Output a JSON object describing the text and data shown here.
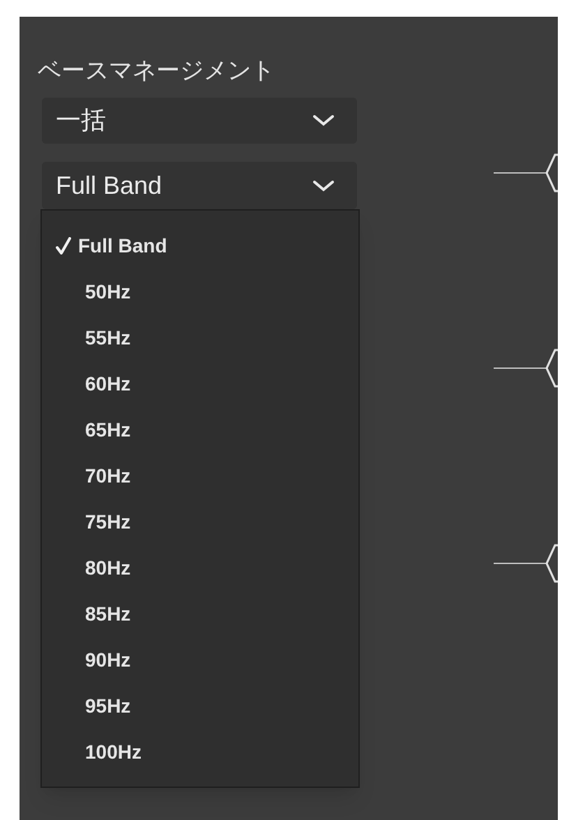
{
  "section_title": "ベースマネージメント",
  "mode_dropdown": {
    "value": "一括"
  },
  "band_dropdown": {
    "value": "Full Band",
    "expanded": true,
    "options": [
      {
        "label": "Full Band",
        "selected": true
      },
      {
        "label": "50Hz",
        "selected": false
      },
      {
        "label": "55Hz",
        "selected": false
      },
      {
        "label": "60Hz",
        "selected": false
      },
      {
        "label": "65Hz",
        "selected": false
      },
      {
        "label": "70Hz",
        "selected": false
      },
      {
        "label": "75Hz",
        "selected": false
      },
      {
        "label": "80Hz",
        "selected": false
      },
      {
        "label": "85Hz",
        "selected": false
      },
      {
        "label": "90Hz",
        "selected": false
      },
      {
        "label": "95Hz",
        "selected": false
      },
      {
        "label": "100Hz",
        "selected": false
      }
    ]
  }
}
